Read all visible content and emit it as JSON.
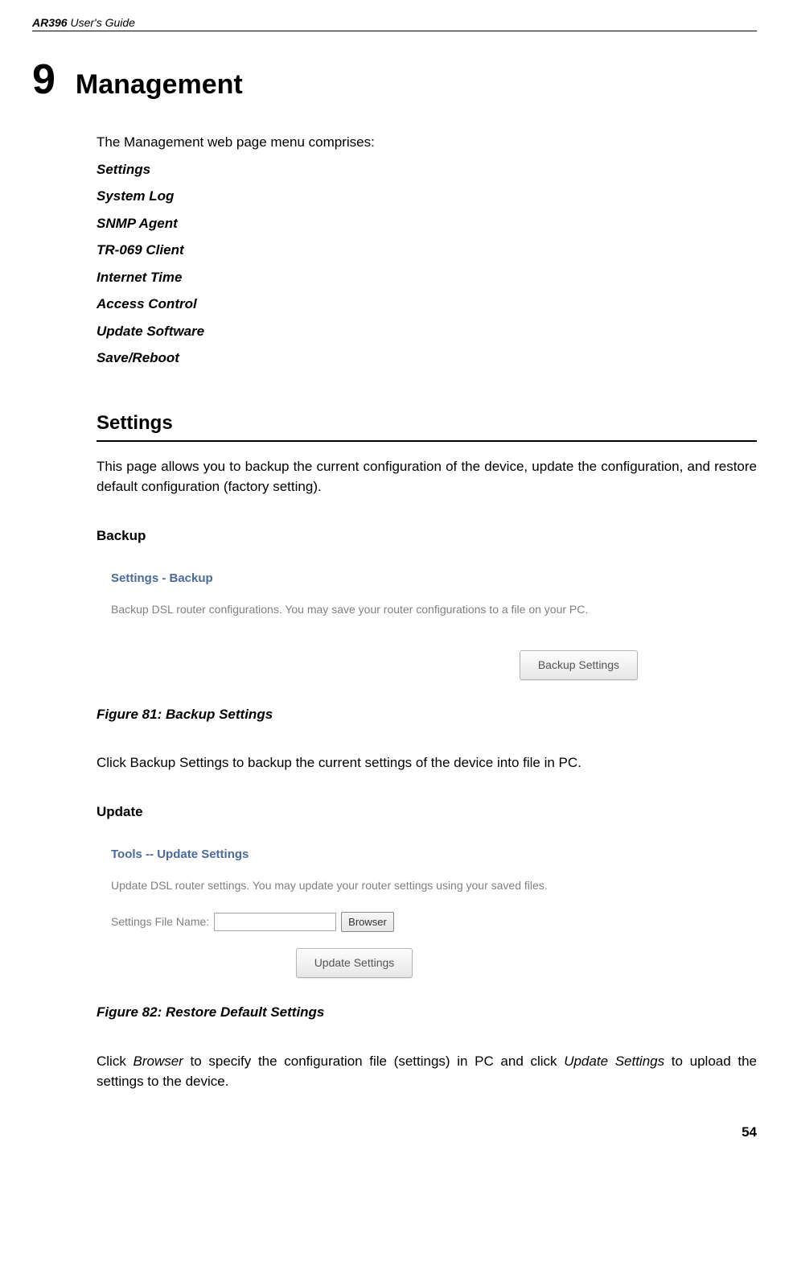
{
  "header": {
    "product": "AR396",
    "doc": "User's Guide"
  },
  "chapter": {
    "number": "9",
    "title": "Management"
  },
  "intro": "The Management web page menu comprises:",
  "menu_items": [
    "Settings",
    "System Log",
    "SNMP Agent",
    "TR-069 Client",
    "Internet Time",
    "Access Control",
    "Update Software",
    "Save/Reboot"
  ],
  "section_settings": {
    "heading": "Settings",
    "body": "This page allows you to backup the current configuration of the device, update the configuration, and restore default configuration (factory setting)."
  },
  "backup": {
    "heading": "Backup",
    "ss_title": "Settings - Backup",
    "ss_desc": "Backup DSL router configurations. You may save your router configurations to a file on your PC.",
    "ss_button": "Backup Settings",
    "caption": "Figure 81: Backup Settings",
    "after": "Click Backup Settings to backup the current settings of the device into file in PC."
  },
  "update": {
    "heading": "Update",
    "ss_title": "Tools -- Update Settings",
    "ss_desc": "Update DSL router settings. You may update your router settings using your saved files.",
    "ss_label": "Settings File Name:",
    "ss_browse": "Browser",
    "ss_button": "Update Settings",
    "caption": "Figure 82: Restore Default Settings",
    "after_pre": "Click ",
    "after_em1": "Browser",
    "after_mid": " to specify the configuration file (settings) in PC and click ",
    "after_em2": "Update Settings",
    "after_post": " to upload the settings to the device."
  },
  "page_number": "54"
}
